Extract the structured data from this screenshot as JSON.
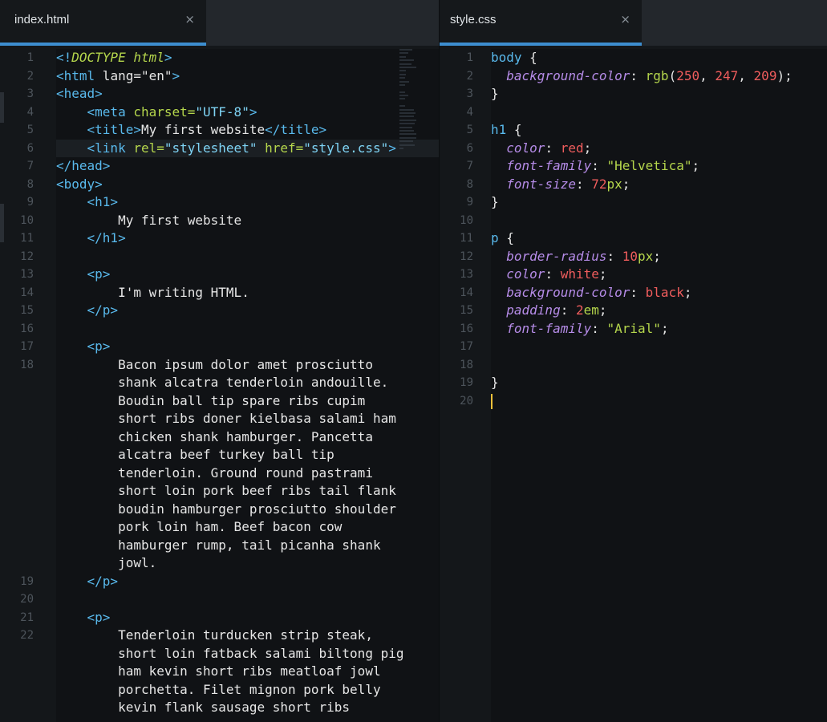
{
  "tabs": {
    "left": {
      "label": "index.html"
    },
    "right": {
      "label": "style.css"
    },
    "close": "×"
  },
  "html_file": {
    "rows": [
      {
        "ln": "1",
        "segs": [
          [
            "t-tag",
            "<!"
          ],
          [
            "t-doc",
            "DOCTYPE html"
          ],
          [
            "t-tag",
            ">"
          ]
        ]
      },
      {
        "ln": "2",
        "segs": [
          [
            "t-tag",
            "<html"
          ],
          [
            "t-punc",
            " lang=\"en\""
          ],
          [
            "t-tag",
            ">"
          ]
        ]
      },
      {
        "ln": "3",
        "segs": [
          [
            "t-tag",
            "<head>"
          ]
        ]
      },
      {
        "ln": "4",
        "segs": [
          [
            "t-punc",
            "    "
          ],
          [
            "t-tag",
            "<meta "
          ],
          [
            "t-attr",
            "charset="
          ],
          [
            "t-str",
            "\"UTF-8\""
          ],
          [
            "t-tag",
            ">"
          ]
        ]
      },
      {
        "ln": "5",
        "segs": [
          [
            "t-punc",
            "    "
          ],
          [
            "t-tag",
            "<title>"
          ],
          [
            "t-punc",
            "My first website"
          ],
          [
            "t-tag",
            "</title>"
          ]
        ]
      },
      {
        "ln": "6",
        "segs": [
          [
            "t-punc",
            "    "
          ],
          [
            "t-tag",
            "<link "
          ],
          [
            "t-attr",
            "rel="
          ],
          [
            "t-str",
            "\"stylesheet\""
          ],
          [
            "t-punc",
            " "
          ],
          [
            "t-attr",
            "href="
          ],
          [
            "t-str",
            "\"style.css\""
          ],
          [
            "t-tag",
            ">"
          ]
        ]
      },
      {
        "ln": "7",
        "segs": [
          [
            "t-tag",
            "</head>"
          ]
        ]
      },
      {
        "ln": "8",
        "segs": [
          [
            "t-tag",
            "<body>"
          ]
        ]
      },
      {
        "ln": "9",
        "segs": [
          [
            "t-punc",
            "    "
          ],
          [
            "t-tag",
            "<h1>"
          ]
        ]
      },
      {
        "ln": "10",
        "segs": [
          [
            "t-punc",
            "        My first website"
          ]
        ]
      },
      {
        "ln": "11",
        "segs": [
          [
            "t-punc",
            "    "
          ],
          [
            "t-tag",
            "</h1>"
          ]
        ]
      },
      {
        "ln": "12",
        "segs": []
      },
      {
        "ln": "13",
        "segs": [
          [
            "t-punc",
            "    "
          ],
          [
            "t-tag",
            "<p>"
          ]
        ]
      },
      {
        "ln": "14",
        "segs": [
          [
            "t-punc",
            "        I'm writing HTML."
          ]
        ]
      },
      {
        "ln": "15",
        "segs": [
          [
            "t-punc",
            "    "
          ],
          [
            "t-tag",
            "</p>"
          ]
        ]
      },
      {
        "ln": "16",
        "segs": []
      },
      {
        "ln": "17",
        "segs": [
          [
            "t-punc",
            "    "
          ],
          [
            "t-tag",
            "<p>"
          ]
        ]
      },
      {
        "ln": "18",
        "segs": [
          [
            "t-punc",
            "        Bacon ipsum dolor amet prosciutto"
          ]
        ]
      },
      {
        "ln": "",
        "segs": [
          [
            "t-punc",
            "        shank alcatra tenderloin andouille."
          ]
        ]
      },
      {
        "ln": "",
        "segs": [
          [
            "t-punc",
            "        Boudin ball tip spare ribs cupim"
          ]
        ]
      },
      {
        "ln": "",
        "segs": [
          [
            "t-punc",
            "        short ribs doner kielbasa salami ham"
          ]
        ]
      },
      {
        "ln": "",
        "segs": [
          [
            "t-punc",
            "        chicken shank hamburger. Pancetta"
          ]
        ]
      },
      {
        "ln": "",
        "segs": [
          [
            "t-punc",
            "        alcatra beef turkey ball tip"
          ]
        ]
      },
      {
        "ln": "",
        "segs": [
          [
            "t-punc",
            "        tenderloin. Ground round pastrami"
          ]
        ]
      },
      {
        "ln": "",
        "segs": [
          [
            "t-punc",
            "        short loin pork beef ribs tail flank"
          ]
        ]
      },
      {
        "ln": "",
        "segs": [
          [
            "t-punc",
            "        boudin hamburger prosciutto shoulder"
          ]
        ]
      },
      {
        "ln": "",
        "segs": [
          [
            "t-punc",
            "        pork loin ham. Beef bacon cow"
          ]
        ]
      },
      {
        "ln": "",
        "segs": [
          [
            "t-punc",
            "        hamburger rump, tail picanha shank"
          ]
        ]
      },
      {
        "ln": "",
        "segs": [
          [
            "t-punc",
            "        jowl."
          ]
        ]
      },
      {
        "ln": "19",
        "segs": [
          [
            "t-punc",
            "    "
          ],
          [
            "t-tag",
            "</p>"
          ]
        ]
      },
      {
        "ln": "20",
        "segs": []
      },
      {
        "ln": "21",
        "segs": [
          [
            "t-punc",
            "    "
          ],
          [
            "t-tag",
            "<p>"
          ]
        ]
      },
      {
        "ln": "22",
        "segs": [
          [
            "t-punc",
            "        Tenderloin turducken strip steak,"
          ]
        ]
      },
      {
        "ln": "",
        "segs": [
          [
            "t-punc",
            "        short loin fatback salami biltong pig"
          ]
        ]
      },
      {
        "ln": "",
        "segs": [
          [
            "t-punc",
            "        ham kevin short ribs meatloaf jowl"
          ]
        ]
      },
      {
        "ln": "",
        "segs": [
          [
            "t-punc",
            "        porchetta. Filet mignon pork belly"
          ]
        ]
      },
      {
        "ln": "",
        "segs": [
          [
            "t-punc",
            "        kevin flank sausage short ribs"
          ]
        ]
      }
    ]
  },
  "css_file": {
    "rows": [
      {
        "ln": "1",
        "segs": [
          [
            "t-sel",
            "body"
          ],
          [
            "t-punc",
            " {"
          ]
        ]
      },
      {
        "ln": "2",
        "segs": [
          [
            "t-punc",
            "  "
          ],
          [
            "t-prop",
            "background-color"
          ],
          [
            "t-punc",
            ": "
          ],
          [
            "t-fn",
            "rgb"
          ],
          [
            "t-punc",
            "("
          ],
          [
            "t-num",
            "250"
          ],
          [
            "t-punc",
            ", "
          ],
          [
            "t-num",
            "247"
          ],
          [
            "t-punc",
            ", "
          ],
          [
            "t-num",
            "209"
          ],
          [
            "t-punc",
            ");"
          ]
        ]
      },
      {
        "ln": "3",
        "segs": [
          [
            "t-punc",
            "}"
          ]
        ]
      },
      {
        "ln": "4",
        "segs": []
      },
      {
        "ln": "5",
        "segs": [
          [
            "t-sel",
            "h1"
          ],
          [
            "t-punc",
            " {"
          ]
        ]
      },
      {
        "ln": "6",
        "segs": [
          [
            "t-punc",
            "  "
          ],
          [
            "t-prop",
            "color"
          ],
          [
            "t-punc",
            ": "
          ],
          [
            "t-kw",
            "red"
          ],
          [
            "t-punc",
            ";"
          ]
        ]
      },
      {
        "ln": "7",
        "segs": [
          [
            "t-punc",
            "  "
          ],
          [
            "t-prop",
            "font-family"
          ],
          [
            "t-punc",
            ": "
          ],
          [
            "t-attr",
            "\"Helvetica\""
          ],
          [
            "t-punc",
            ";"
          ]
        ]
      },
      {
        "ln": "8",
        "segs": [
          [
            "t-punc",
            "  "
          ],
          [
            "t-prop",
            "font-size"
          ],
          [
            "t-punc",
            ": "
          ],
          [
            "t-num",
            "72"
          ],
          [
            "t-unit",
            "px"
          ],
          [
            "t-punc",
            ";"
          ]
        ]
      },
      {
        "ln": "9",
        "segs": [
          [
            "t-punc",
            "}"
          ]
        ]
      },
      {
        "ln": "10",
        "segs": []
      },
      {
        "ln": "11",
        "segs": [
          [
            "t-sel",
            "p"
          ],
          [
            "t-punc",
            " {"
          ]
        ]
      },
      {
        "ln": "12",
        "segs": [
          [
            "t-punc",
            "  "
          ],
          [
            "t-prop",
            "border-radius"
          ],
          [
            "t-punc",
            ": "
          ],
          [
            "t-num",
            "10"
          ],
          [
            "t-unit",
            "px"
          ],
          [
            "t-punc",
            ";"
          ]
        ]
      },
      {
        "ln": "13",
        "segs": [
          [
            "t-punc",
            "  "
          ],
          [
            "t-prop",
            "color"
          ],
          [
            "t-punc",
            ": "
          ],
          [
            "t-kw",
            "white"
          ],
          [
            "t-punc",
            ";"
          ]
        ]
      },
      {
        "ln": "14",
        "segs": [
          [
            "t-punc",
            "  "
          ],
          [
            "t-prop",
            "background-color"
          ],
          [
            "t-punc",
            ": "
          ],
          [
            "t-kw",
            "black"
          ],
          [
            "t-punc",
            ";"
          ]
        ]
      },
      {
        "ln": "15",
        "segs": [
          [
            "t-punc",
            "  "
          ],
          [
            "t-prop",
            "padding"
          ],
          [
            "t-punc",
            ": "
          ],
          [
            "t-num",
            "2"
          ],
          [
            "t-unit",
            "em"
          ],
          [
            "t-punc",
            ";"
          ]
        ]
      },
      {
        "ln": "16",
        "segs": [
          [
            "t-punc",
            "  "
          ],
          [
            "t-prop",
            "font-family"
          ],
          [
            "t-punc",
            ": "
          ],
          [
            "t-attr",
            "\"Arial\""
          ],
          [
            "t-punc",
            ";"
          ]
        ]
      },
      {
        "ln": "17",
        "segs": []
      },
      {
        "ln": "18",
        "segs": []
      },
      {
        "ln": "19",
        "segs": [
          [
            "t-punc",
            "}"
          ]
        ]
      },
      {
        "ln": "20",
        "segs": [],
        "cursor": true
      }
    ]
  },
  "theme": {
    "accent": "#3d8ed0",
    "tag": "#59b9ec",
    "attr": "#b5d64c",
    "property": "#b68ce8",
    "number": "#f05d5d",
    "cursor": "#f3c13a"
  }
}
